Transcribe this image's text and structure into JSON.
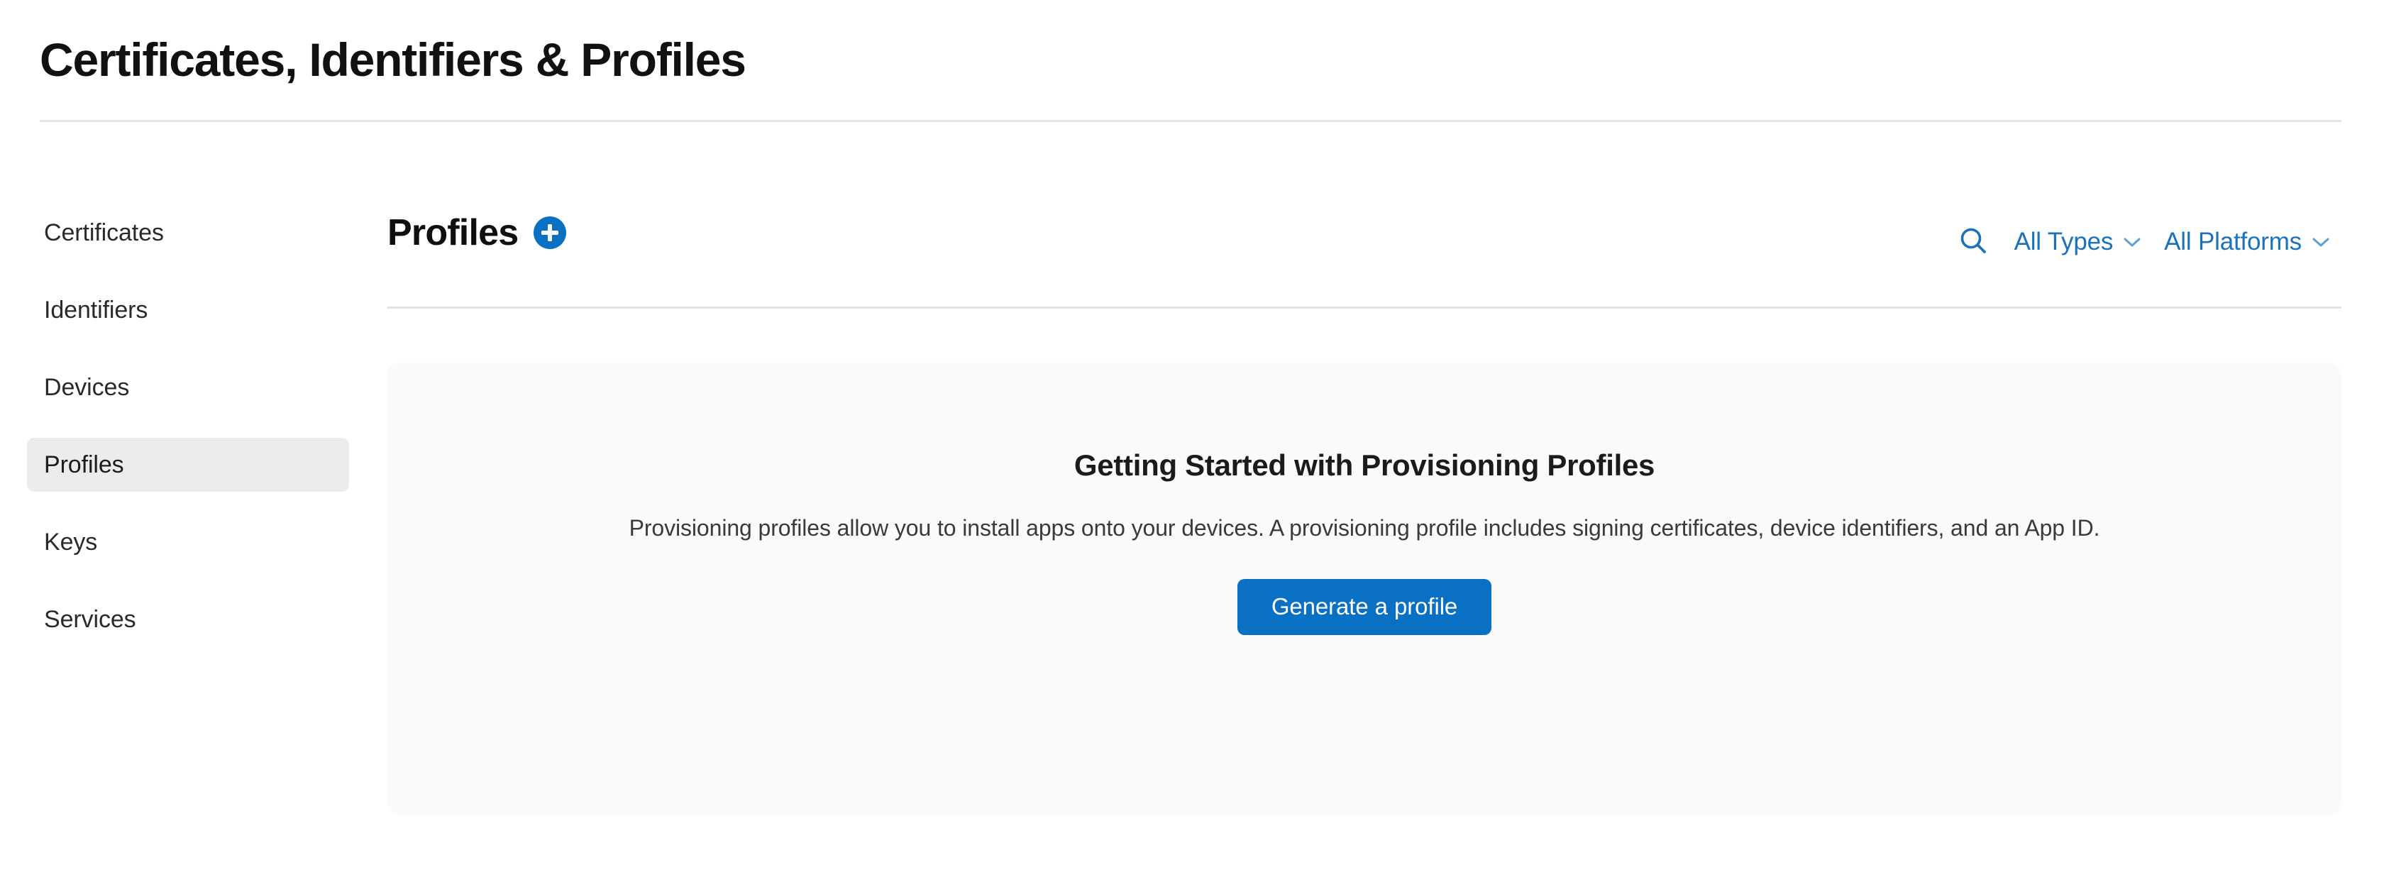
{
  "header": {
    "title": "Certificates, Identifiers & Profiles"
  },
  "sidebar": {
    "items": [
      {
        "label": "Certificates",
        "selected": false
      },
      {
        "label": "Identifiers",
        "selected": false
      },
      {
        "label": "Devices",
        "selected": false
      },
      {
        "label": "Profiles",
        "selected": true
      },
      {
        "label": "Keys",
        "selected": false
      },
      {
        "label": "Services",
        "selected": false
      }
    ]
  },
  "main": {
    "section_title": "Profiles",
    "add_button_icon": "plus-icon",
    "filters": {
      "search_icon": "search-icon",
      "types": {
        "label": "All Types",
        "chevron": "chevron-down-icon"
      },
      "platforms": {
        "label": "All Platforms",
        "chevron": "chevron-down-icon"
      }
    },
    "empty_state": {
      "title": "Getting Started with Provisioning Profiles",
      "body": "Provisioning profiles allow you to install apps onto your devices. A provisioning profile includes signing certificates, device identifiers, and an App ID.",
      "cta_label": "Generate a profile"
    }
  },
  "colors": {
    "accent_blue": "#0a70c4",
    "link_blue": "#1b72bb",
    "panel_bg": "#fafafa",
    "selected_nav_bg": "#ececec",
    "divider": "#e2e2e2"
  }
}
